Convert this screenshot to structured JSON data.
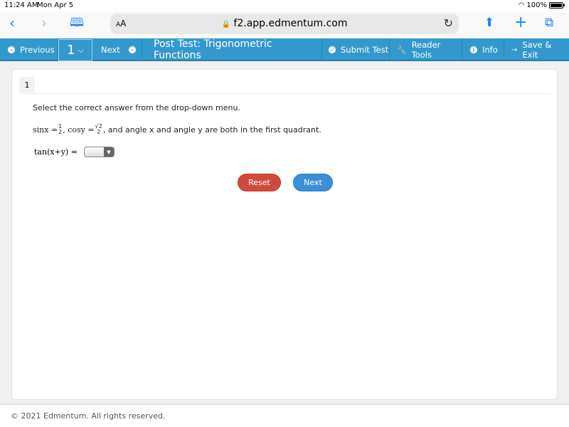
{
  "status_bar": {
    "time": "11:24 AM",
    "date": "Mon Apr 5",
    "battery": "100%"
  },
  "browser": {
    "text_size_label": "AA",
    "url": "f2.app.edmentum.com",
    "icons": [
      "back-icon",
      "forward-icon",
      "bookmarks-icon",
      "lock-icon",
      "reload-icon",
      "share-icon",
      "new-tab-icon",
      "tabs-icon"
    ]
  },
  "toolbar": {
    "previous_label": "Previous",
    "page_number": "1",
    "next_label": "Next",
    "title": "Post Test: Trigonometric Functions",
    "submit_label": "Submit Test",
    "reader_tools_label": "Reader Tools",
    "info_label": "Info",
    "save_exit_label": "Save & Exit",
    "accent_color": "#3399cc"
  },
  "question": {
    "number": "1",
    "instruction": "Select the correct answer from the drop-down menu.",
    "sin_lhs": "sinx =",
    "sin_num": "1",
    "sin_den": "2",
    "cos_lhs": ", cosy =",
    "cos_num": "√2",
    "cos_den": "2",
    "prompt_suffix": ", and angle x and angle y are both in the first quadrant.",
    "answer_label": "tan(x+y) =",
    "dropdown_value": ""
  },
  "buttons": {
    "reset": "Reset",
    "next": "Next",
    "reset_color": "#d14b3b",
    "next_color": "#3b8fd9"
  },
  "footer": {
    "copyright": "© 2021 Edmentum. All rights reserved."
  }
}
